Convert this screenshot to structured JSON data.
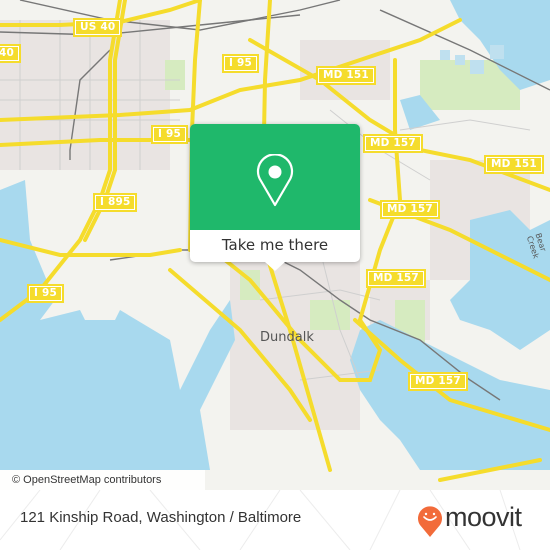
{
  "map": {
    "place_label": "Dundalk",
    "creek_label": "Bear Creek",
    "road_shields": [
      {
        "id": "us40-a",
        "label": "US 40"
      },
      {
        "id": "us40-b",
        "label": "40"
      },
      {
        "id": "i95-a",
        "label": "I 95"
      },
      {
        "id": "md151-a",
        "label": "MD 151"
      },
      {
        "id": "i95-b",
        "label": "I 95"
      },
      {
        "id": "md157-a",
        "label": "MD 157"
      },
      {
        "id": "md151-b",
        "label": "MD 151"
      },
      {
        "id": "i895",
        "label": "I 895"
      },
      {
        "id": "md157-b",
        "label": "MD 157"
      },
      {
        "id": "md157-c",
        "label": "MD 157"
      },
      {
        "id": "i95-c",
        "label": "I 95"
      },
      {
        "id": "md157-d",
        "label": "MD 157"
      }
    ],
    "attribution": "© OpenStreetMap contributors",
    "colors": {
      "water": "#a8d9ee",
      "land": "#f3f3ef",
      "road": "#f5dc2c",
      "park": "#d6ebc0",
      "urban": "#e9e4e2"
    }
  },
  "popup": {
    "icon": "location-pin-icon",
    "button_label": "Take me there",
    "color": "#1fb86b"
  },
  "footer": {
    "address": "121 Kinship Road, Washington / Baltimore",
    "brand": "moovit",
    "brand_color": "#f26b3a"
  }
}
